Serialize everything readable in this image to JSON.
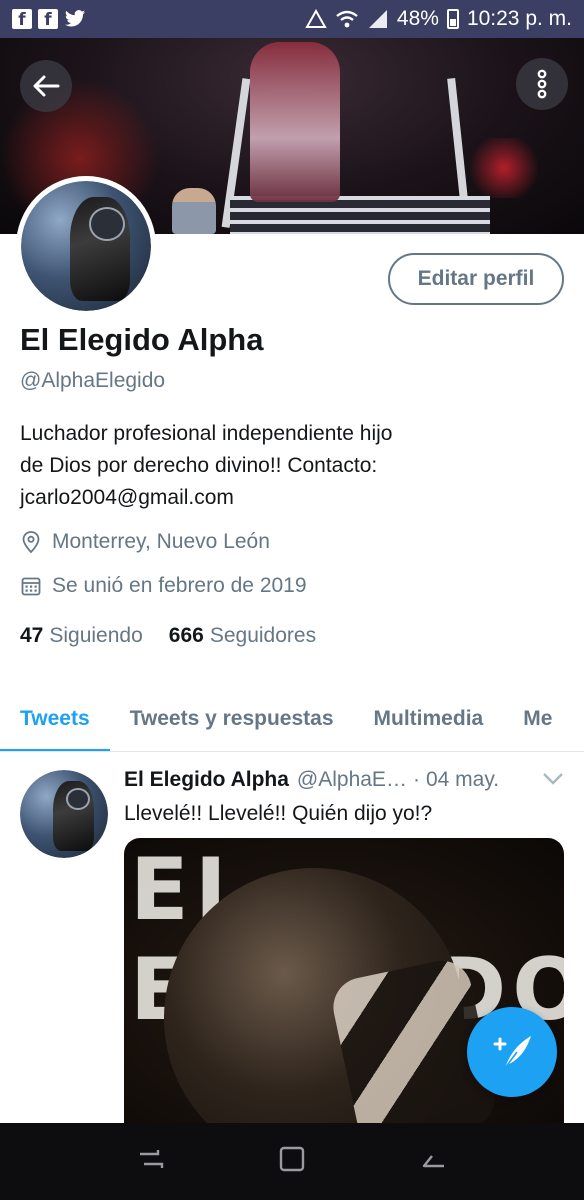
{
  "status_bar": {
    "battery": "48%",
    "time": "10:23 p. m.",
    "notification_icons": [
      "facebook-icon",
      "facebook-icon",
      "twitter-icon"
    ]
  },
  "profile": {
    "name": "El Elegido Alpha",
    "handle": "@AlphaElegido",
    "bio_lines": [
      "Luchador profesional independiente hijo",
      "de Dios por derecho divino!! Contacto:",
      "jcarlo2004@gmail.com"
    ],
    "location": "Monterrey, Nuevo León",
    "joined": "Se unió en febrero de 2019",
    "following_count": "47",
    "following_label": "Siguiendo",
    "followers_count": "666",
    "followers_label": "Seguidores",
    "edit_label": "Editar perfil"
  },
  "tabs": [
    {
      "label": "Tweets",
      "active": true
    },
    {
      "label": "Tweets y respuestas",
      "active": false
    },
    {
      "label": "Multimedia",
      "active": false
    },
    {
      "label": "Me",
      "active": false
    }
  ],
  "tweet": {
    "author": "El Elegido Alpha",
    "handle": "@AlphaE…",
    "separator": "·",
    "date": "04 may.",
    "text": "Llevelé!! Llevelé!! Quién dijo yo!?",
    "media_text": "EL ELEGIDO"
  },
  "colors": {
    "accent": "#1da1f2",
    "secondary_text": "#657786",
    "status_bar": "#3b3f63"
  }
}
